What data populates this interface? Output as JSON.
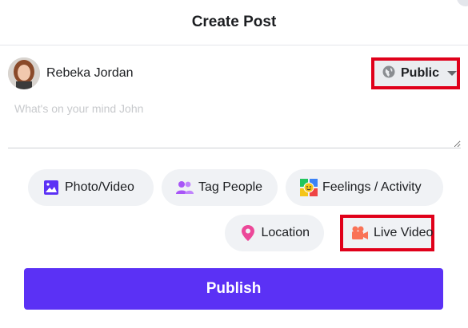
{
  "dialog": {
    "title": "Create Post"
  },
  "user": {
    "name": "Rebeka Jordan"
  },
  "privacy": {
    "label": "Public",
    "icon": "globe-icon"
  },
  "composer": {
    "placeholder": "What's on your mind John"
  },
  "actions": [
    {
      "label": "Photo/Video",
      "icon": "photo-icon",
      "color": "#5b31f5"
    },
    {
      "label": "Tag People",
      "icon": "people-icon",
      "color": "#a855f7"
    },
    {
      "label": "Feelings / Activity",
      "icon": "emoji-icon",
      "color": "#f5c518"
    },
    {
      "label": "Location",
      "icon": "location-pin-icon",
      "color": "#ec4899"
    },
    {
      "label": "Live Video",
      "icon": "video-camera-icon",
      "color": "#f97357"
    }
  ],
  "publish": {
    "label": "Publish",
    "color": "#5b31f5"
  }
}
